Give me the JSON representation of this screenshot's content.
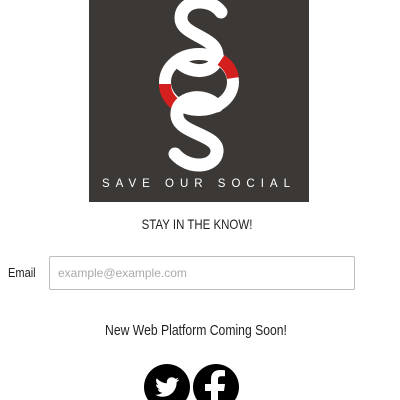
{
  "brand": {
    "logo_text": "SAVE OUR SOCIAL",
    "logo_bg": "#3b3835",
    "accent": "#d41f1f"
  },
  "signup": {
    "tagline": "STAY IN THE KNOW!",
    "email_label": "Email",
    "email_placeholder": "example@example.com",
    "email_value": ""
  },
  "announcement": "New Web Platform Coming Soon!",
  "social": {
    "twitter_icon": "twitter-bird-icon",
    "facebook_icon": "facebook-f-icon"
  }
}
